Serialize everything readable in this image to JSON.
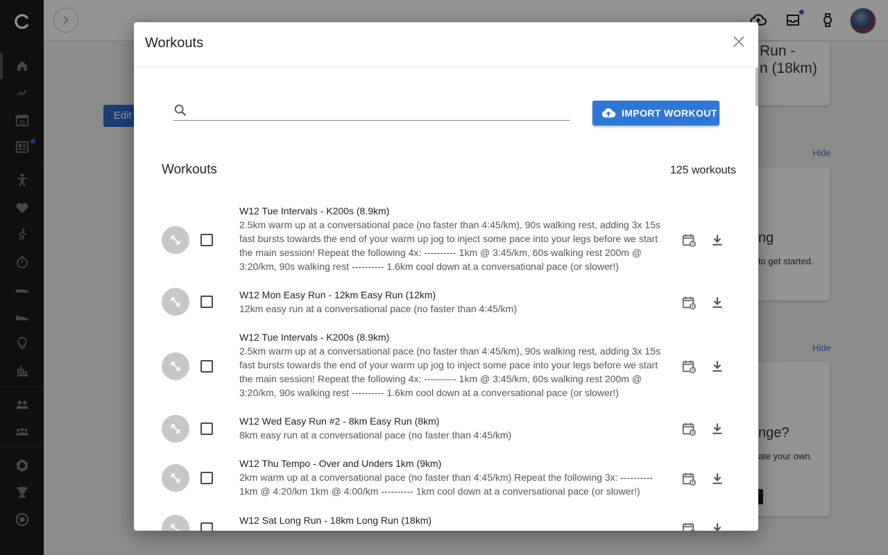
{
  "sidebar": {
    "icons": [
      "logo-icon",
      "home-icon",
      "activity-icon",
      "calendar-icon",
      "news-icon",
      "athlete-icon",
      "heart-icon",
      "running-icon",
      "stopwatch-icon",
      "shoe-icon",
      "shoe-icon",
      "lightbulb-icon",
      "bar-chart-icon",
      "group-icon",
      "team-icon",
      "hexagon-icon",
      "trophy-icon",
      "target-icon"
    ],
    "calendar_day": "31"
  },
  "background": {
    "edit_label": "Edit",
    "card1_text_a": "Run -",
    "card1_text_b": "n (18km)",
    "hide_label": "Hide",
    "card2_text": "ng",
    "card2_sub": "to get started.",
    "card3_text": "nge?",
    "card3_sub": "ate your own."
  },
  "modal": {
    "title": "Workouts",
    "search": {
      "placeholder": "",
      "value": ""
    },
    "import_label": "IMPORT WORKOUT",
    "list_title": "Workouts",
    "count": "125 workouts",
    "workouts": [
      {
        "name": "W12 Tue Intervals - K200s (8.9km)",
        "description": "2.5km warm up at a conversational pace (no faster than 4:45/km), 90s walking rest, adding 3x 15s fast bursts towards the end of your warm up jog to inject some pace into your legs before we start the main session! Repeat the following 4x: ---------- 1km @ 3:45/km, 60s walking rest 200m @ 3:20/km, 90s walking rest ---------- 1.6km cool down at a conversational pace (or slower!)"
      },
      {
        "name": "W12 Mon Easy Run - 12km Easy Run (12km)",
        "description": "12km easy run at a conversational pace (no faster than 4:45/km)"
      },
      {
        "name": "W12 Tue Intervals - K200s (8.9km)",
        "description": "2.5km warm up at a conversational pace (no faster than 4:45/km), 90s walking rest, adding 3x 15s fast bursts towards the end of your warm up jog to inject some pace into your legs before we start the main session! Repeat the following 4x: ---------- 1km @ 3:45/km, 60s walking rest 200m @ 3:20/km, 90s walking rest ---------- 1.6km cool down at a conversational pace (or slower!)"
      },
      {
        "name": "W12 Wed Easy Run #2 - 8km Easy Run (8km)",
        "description": "8km easy run at a conversational pace (no faster than 4:45/km)"
      },
      {
        "name": "W12 Thu Tempo - Over and Unders 1km (9km)",
        "description": "2km warm up at a conversational pace (no faster than 4:45/km) Repeat the following 3x: ---------- 1km @ 4:20/km 1km @ 4:00/km ---------- 1km cool down at a conversational pace (or slower!)"
      },
      {
        "name": "W12 Sat Long Run - 18km Long Run (18km)",
        "description": ""
      }
    ]
  },
  "colors": {
    "accent": "#2f77d6",
    "sidebar": "#1b1b1b",
    "notification": "#1e63c7"
  }
}
